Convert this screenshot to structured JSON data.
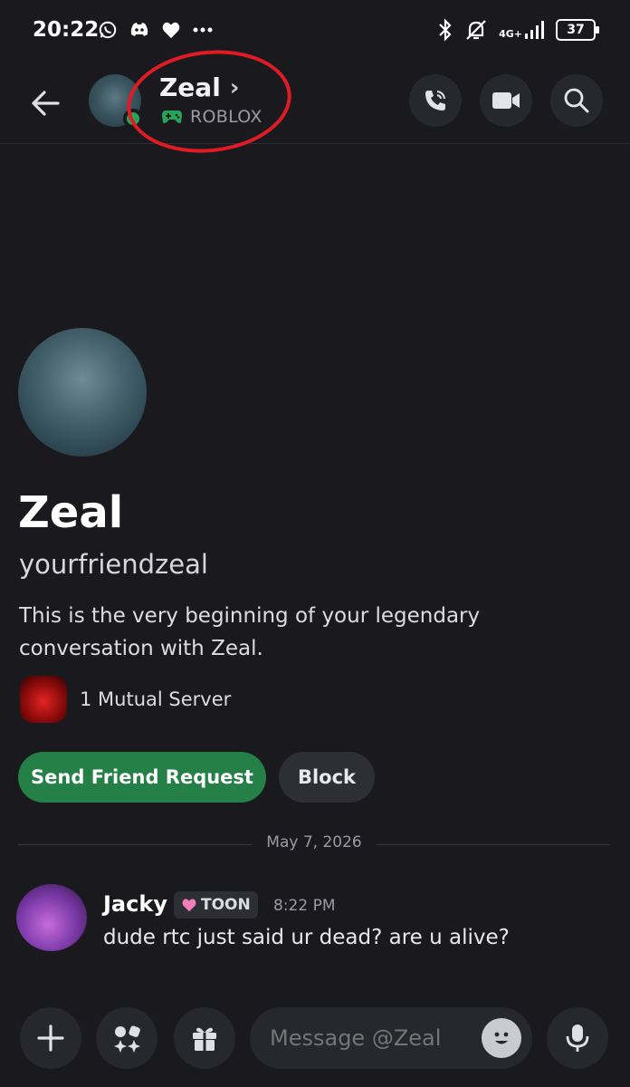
{
  "status_bar": {
    "time": "20:22",
    "network": "4G+",
    "battery": "37"
  },
  "header": {
    "name": "Zeal",
    "activity": "ROBLOX",
    "chevron": "›"
  },
  "intro": {
    "display_name": "Zeal",
    "username": "yourfriendzeal",
    "description": "This is the very beginning of your legendary conversation with Zeal.",
    "mutual_servers": "1 Mutual Server",
    "send_friend_request_label": "Send Friend Request",
    "block_label": "Block"
  },
  "divider": {
    "date": "May 7, 2026"
  },
  "messages": [
    {
      "author": "Jacky",
      "tag": "TOON",
      "time": "8:22 PM",
      "text": "dude rtc just said ur dead? are u alive?"
    }
  ],
  "composer": {
    "placeholder": "Message @Zeal"
  },
  "colors": {
    "background": "#1a1a1e",
    "online_green": "#23a55a",
    "friend_button": "#248046",
    "annotation_red": "#e01b24"
  }
}
